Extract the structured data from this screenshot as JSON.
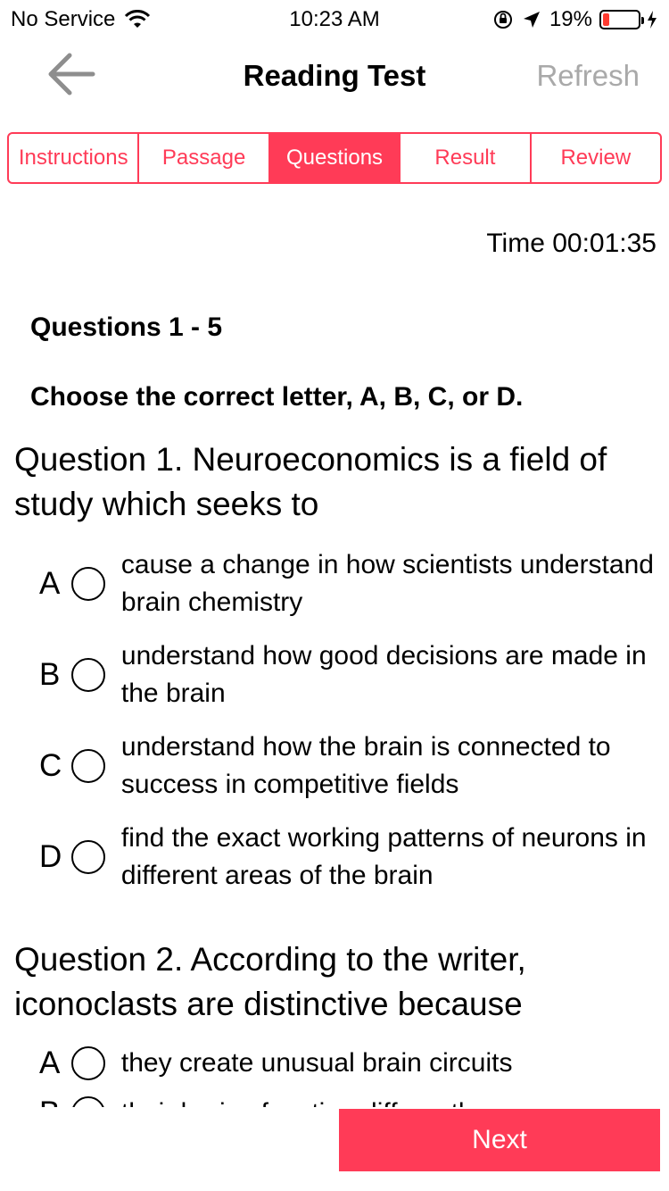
{
  "status": {
    "carrier": "No Service",
    "time": "10:23 AM",
    "battery_percent": "19%",
    "battery_level": 0.19,
    "battery_color": "#ff3b30"
  },
  "nav": {
    "title": "Reading Test",
    "refresh_label": "Refresh",
    "back_icon": "arrow-left-icon"
  },
  "tabs": [
    {
      "label": "Instructions",
      "active": false
    },
    {
      "label": "Passage",
      "active": false
    },
    {
      "label": "Questions",
      "active": true
    },
    {
      "label": "Result",
      "active": false
    },
    {
      "label": "Review",
      "active": false
    }
  ],
  "timer": "Time 00:01:35",
  "section": {
    "heading": "Questions 1 - 5",
    "instruction": "Choose the correct letter, A, B, C, or D."
  },
  "questions": [
    {
      "title": "Question 1. Neuroeconomics is a field of study which seeks to",
      "options": [
        {
          "letter": "A",
          "text": "cause a change in how scientists understand brain chemistry"
        },
        {
          "letter": "B",
          "text": "understand how good decisions are made in the brain"
        },
        {
          "letter": "C",
          "text": "understand how the brain is connected to success in competitive fields"
        },
        {
          "letter": "D",
          "text": "find the exact working patterns of neurons in different areas of the brain"
        }
      ]
    },
    {
      "title": "Question 2. According to the writer, iconoclasts are distinctive because",
      "options": [
        {
          "letter": "A",
          "text": "they create unusual brain circuits"
        },
        {
          "letter": "B",
          "text": "their brains function differently"
        }
      ]
    }
  ],
  "next_label": "Next",
  "accent_color": "#ff3b57"
}
